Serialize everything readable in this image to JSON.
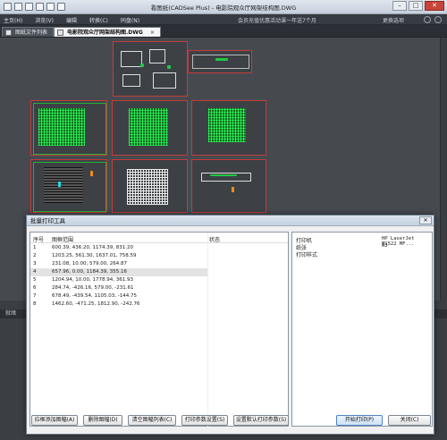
{
  "app": {
    "title": "看图纸(CADSee Plus) - 电影院观众厅网架结构图.DWG"
  },
  "menubar": {
    "items": [
      "主页(H)",
      "浏览(V)",
      "编辑",
      "转换(C)",
      "同盘(N)"
    ],
    "member_text": "会员充值优惠活动课一年送7个月",
    "theme_label": "更换选项"
  },
  "tabs": [
    {
      "label": "图纸文件列表"
    },
    {
      "label": "电影院观众厅网架结构图.DWG"
    }
  ],
  "status": {
    "label": "就绪"
  },
  "dialog": {
    "title": "批量打印工具",
    "close_label": "✕",
    "columns": {
      "no": "序号",
      "range": "图框范围",
      "status": "状态"
    },
    "rows": [
      {
        "no": "1",
        "range": "600.39, 436.20, 1174.39, 831.20"
      },
      {
        "no": "2",
        "range": "1203.25, 561.30, 1637.01, 758.59"
      },
      {
        "no": "3",
        "range": "231.08, 10.00, 579.00, 264.87"
      },
      {
        "no": "4",
        "range": "657.96, 0.00, 1184.39, 355.16"
      },
      {
        "no": "5",
        "range": "1204.94, 10.00, 1778.94, 361.93"
      },
      {
        "no": "6",
        "range": "284.74, -426.16, 579.00, -231.61"
      },
      {
        "no": "7",
        "range": "678.49, -439.54, 1105.03, -144.75"
      },
      {
        "no": "8",
        "range": "1462.60, -471.25, 1812.90, -242.76"
      }
    ],
    "selected_row": 4,
    "props": {
      "printer_label": "打印机",
      "printer_value": "HP LaserJet M1522 MF...",
      "paper_label": "纸张",
      "paper_value": "A3",
      "style_label": "打印样式"
    },
    "buttons": {
      "add_frame": "拉框添加图幅(A)",
      "delete_frame": "删除图幅(D)",
      "clear_list": "清空图幅列表(C)",
      "print_settings": "打印参数设置(S)",
      "default_settings": "设置默认打印参数(S)",
      "start_print": "开始打印(P)",
      "close": "关闭(C)"
    }
  }
}
